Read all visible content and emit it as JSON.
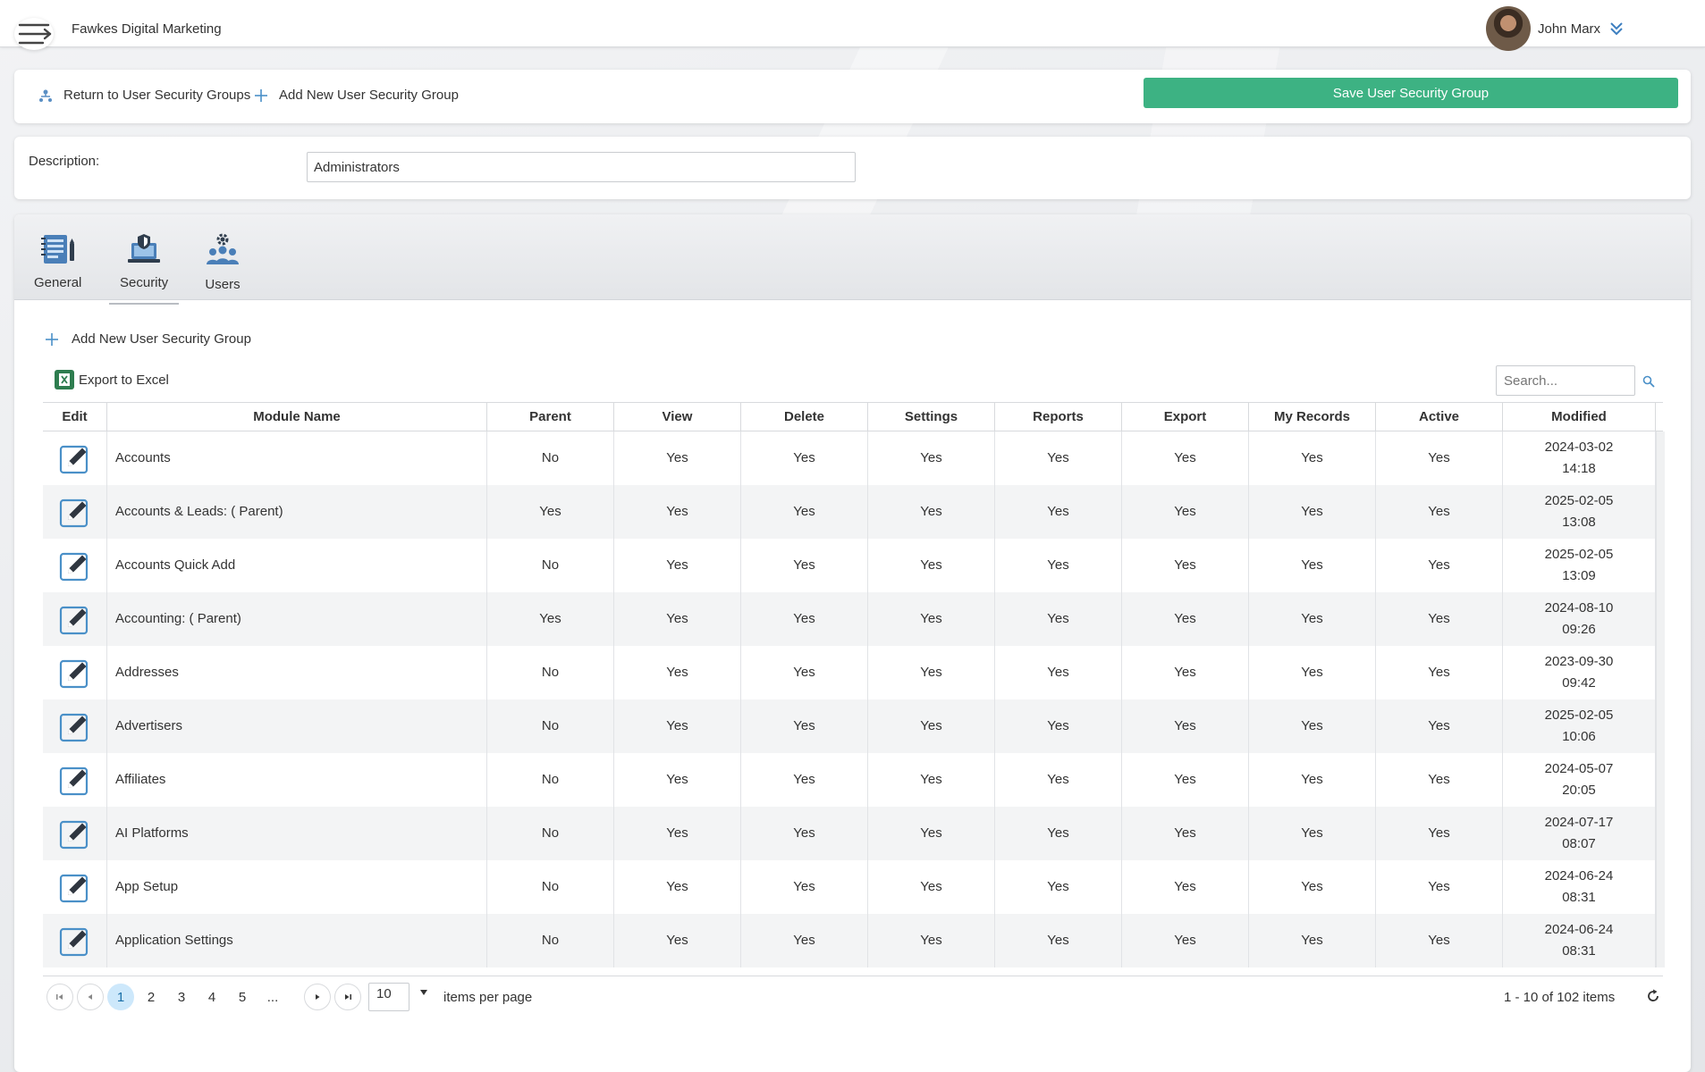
{
  "app": {
    "title": "Fawkes Digital Marketing"
  },
  "user": {
    "name": "John Marx"
  },
  "actions": {
    "return_label": "Return to User Security Groups",
    "add_label": "Add New User Security Group",
    "save_label": "Save User Security Group"
  },
  "description": {
    "label": "Description:",
    "value": "Administrators"
  },
  "tabs": [
    {
      "label": "General",
      "icon": "notebook-icon"
    },
    {
      "label": "Security",
      "icon": "laptop-shield-icon"
    },
    {
      "label": "Users",
      "icon": "users-gear-icon"
    }
  ],
  "grid_toolbar": {
    "add_label": "Add New User Security Group",
    "export_label": "Export to Excel",
    "search_placeholder": "Search..."
  },
  "grid": {
    "columns": [
      "Edit",
      "Module Name",
      "Parent",
      "View",
      "Delete",
      "Settings",
      "Reports",
      "Export",
      "My Records",
      "Active",
      "Modified"
    ],
    "rows": [
      {
        "module": "Accounts",
        "parent": "No",
        "view": "Yes",
        "delete": "Yes",
        "settings": "Yes",
        "reports": "Yes",
        "export": "Yes",
        "my_records": "Yes",
        "active": "Yes",
        "modified_date": "2024-03-02",
        "modified_time": "14:18"
      },
      {
        "module": "Accounts & Leads: ( Parent)",
        "parent": "Yes",
        "view": "Yes",
        "delete": "Yes",
        "settings": "Yes",
        "reports": "Yes",
        "export": "Yes",
        "my_records": "Yes",
        "active": "Yes",
        "modified_date": "2025-02-05",
        "modified_time": "13:08"
      },
      {
        "module": "Accounts Quick Add",
        "parent": "No",
        "view": "Yes",
        "delete": "Yes",
        "settings": "Yes",
        "reports": "Yes",
        "export": "Yes",
        "my_records": "Yes",
        "active": "Yes",
        "modified_date": "2025-02-05",
        "modified_time": "13:09"
      },
      {
        "module": "Accounting: ( Parent)",
        "parent": "Yes",
        "view": "Yes",
        "delete": "Yes",
        "settings": "Yes",
        "reports": "Yes",
        "export": "Yes",
        "my_records": "Yes",
        "active": "Yes",
        "modified_date": "2024-08-10",
        "modified_time": "09:26"
      },
      {
        "module": "Addresses",
        "parent": "No",
        "view": "Yes",
        "delete": "Yes",
        "settings": "Yes",
        "reports": "Yes",
        "export": "Yes",
        "my_records": "Yes",
        "active": "Yes",
        "modified_date": "2023-09-30",
        "modified_time": "09:42"
      },
      {
        "module": "Advertisers",
        "parent": "No",
        "view": "Yes",
        "delete": "Yes",
        "settings": "Yes",
        "reports": "Yes",
        "export": "Yes",
        "my_records": "Yes",
        "active": "Yes",
        "modified_date": "2025-02-05",
        "modified_time": "10:06"
      },
      {
        "module": "Affiliates",
        "parent": "No",
        "view": "Yes",
        "delete": "Yes",
        "settings": "Yes",
        "reports": "Yes",
        "export": "Yes",
        "my_records": "Yes",
        "active": "Yes",
        "modified_date": "2024-05-07",
        "modified_time": "20:05"
      },
      {
        "module": "AI Platforms",
        "parent": "No",
        "view": "Yes",
        "delete": "Yes",
        "settings": "Yes",
        "reports": "Yes",
        "export": "Yes",
        "my_records": "Yes",
        "active": "Yes",
        "modified_date": "2024-07-17",
        "modified_time": "08:07"
      },
      {
        "module": "App Setup",
        "parent": "No",
        "view": "Yes",
        "delete": "Yes",
        "settings": "Yes",
        "reports": "Yes",
        "export": "Yes",
        "my_records": "Yes",
        "active": "Yes",
        "modified_date": "2024-06-24",
        "modified_time": "08:31"
      },
      {
        "module": "Application Settings",
        "parent": "No",
        "view": "Yes",
        "delete": "Yes",
        "settings": "Yes",
        "reports": "Yes",
        "export": "Yes",
        "my_records": "Yes",
        "active": "Yes",
        "modified_date": "2024-06-24",
        "modified_time": "08:31"
      }
    ]
  },
  "pager": {
    "pages": [
      "1",
      "2",
      "3",
      "4",
      "5",
      "..."
    ],
    "current_page": "1",
    "page_size": "10",
    "items_label": "items per page",
    "info": "1 - 10 of 102 items"
  },
  "colors": {
    "accent": "#3db283",
    "icon_blue": "#4a90c8",
    "active_page": "#cde8fb"
  }
}
